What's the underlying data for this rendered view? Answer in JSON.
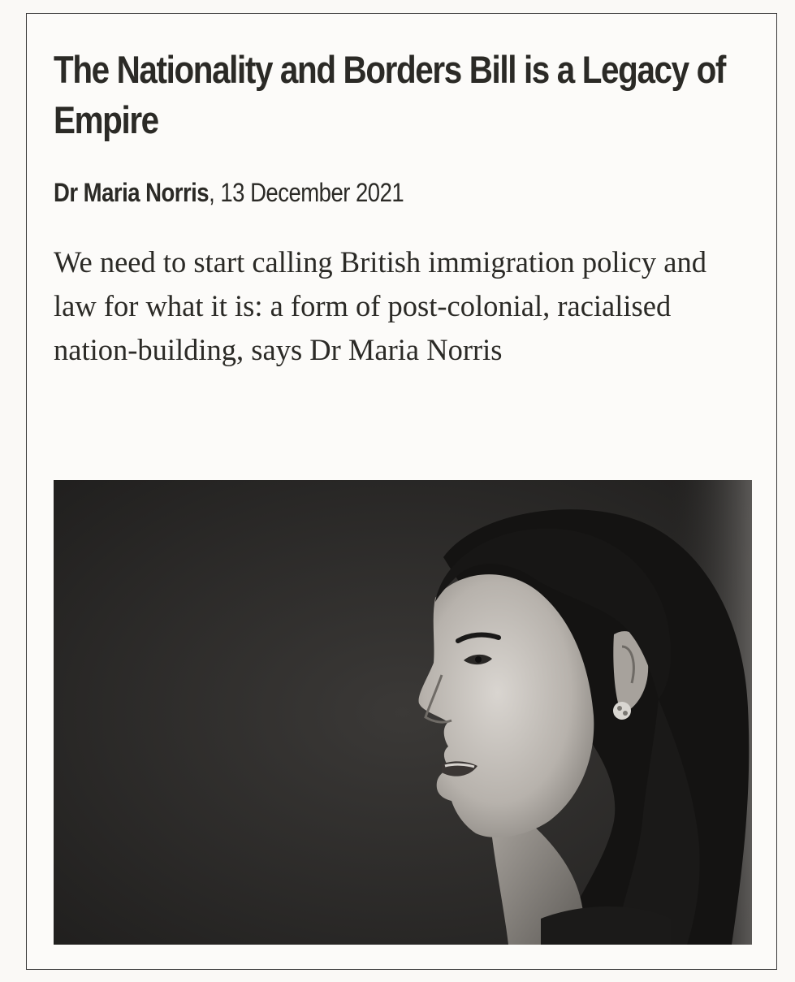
{
  "article": {
    "headline": "The Nationality and Borders Bill is a Legacy of Empire",
    "author": "Dr Maria Norris",
    "date_separator": ", ",
    "date": "13 December 2021",
    "standfirst": "We need to start calling British immigration policy and law for what it is: a form of post-colonial, racialised nation-building, says Dr Maria Norris"
  },
  "photo": {
    "description_icon": "portrait-photo",
    "tone": "black-and-white"
  },
  "colors": {
    "text": "#2b2a26",
    "background": "#fcfbf9",
    "border": "#3a3a3a"
  }
}
